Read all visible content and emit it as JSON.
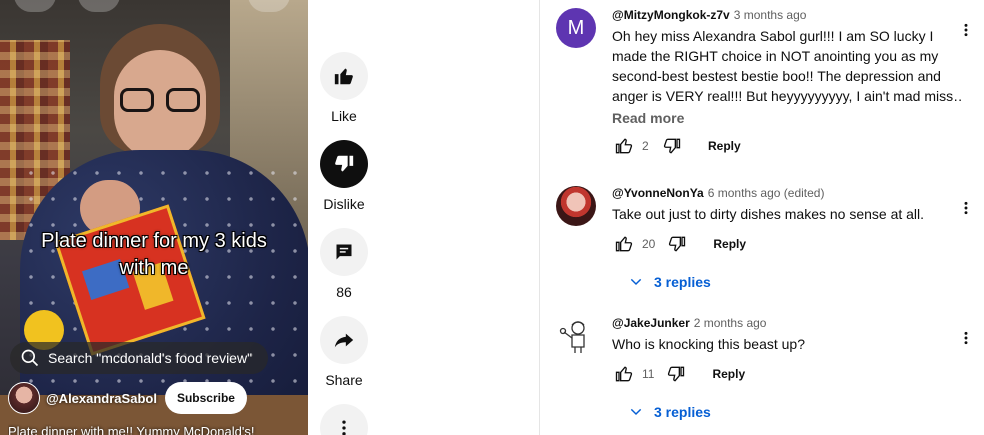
{
  "video": {
    "caption_line1": "Plate dinner for my 3 kids",
    "caption_line2": "with me",
    "search_text": "Search \"mcdonald's food review\"",
    "channel_name": "@AlexandraSabol",
    "subscribe_label": "Subscribe",
    "description": "Plate dinner with me!! Yummy McDonald's!"
  },
  "actions": {
    "like_label": "Like",
    "dislike_label": "Dislike",
    "comments_count": "86",
    "share_label": "Share"
  },
  "comments": [
    {
      "avatar_letter": "M",
      "author": "@MitzyMongkok-z7v",
      "time": "3 months ago",
      "text_lines": [
        "Oh hey miss Alexandra Sabol gurl!!! I am SO lucky I",
        "made the RIGHT choice in NOT anointing you as my",
        "second-best bestest bestie boo!! The depression and",
        "anger is VERY real!!! But heyyyyyyyyy, I ain't mad miss…"
      ],
      "read_more": "Read more",
      "likes": "2",
      "reply_label": "Reply"
    },
    {
      "author": "@YvonneNonYa",
      "time": "6 months ago (edited)",
      "text": "Take out just to dirty dishes makes no sense at all.",
      "likes": "20",
      "reply_label": "Reply",
      "replies_label": "3 replies"
    },
    {
      "author": "@JakeJunker",
      "time": "2 months ago",
      "text": "Who is knocking this beast up?",
      "likes": "11",
      "reply_label": "Reply",
      "replies_label": "3 replies"
    }
  ],
  "colors": {
    "accent_blue": "#065fd4",
    "avatar_purple": "#5e35b1",
    "secondary_text": "#606060"
  }
}
